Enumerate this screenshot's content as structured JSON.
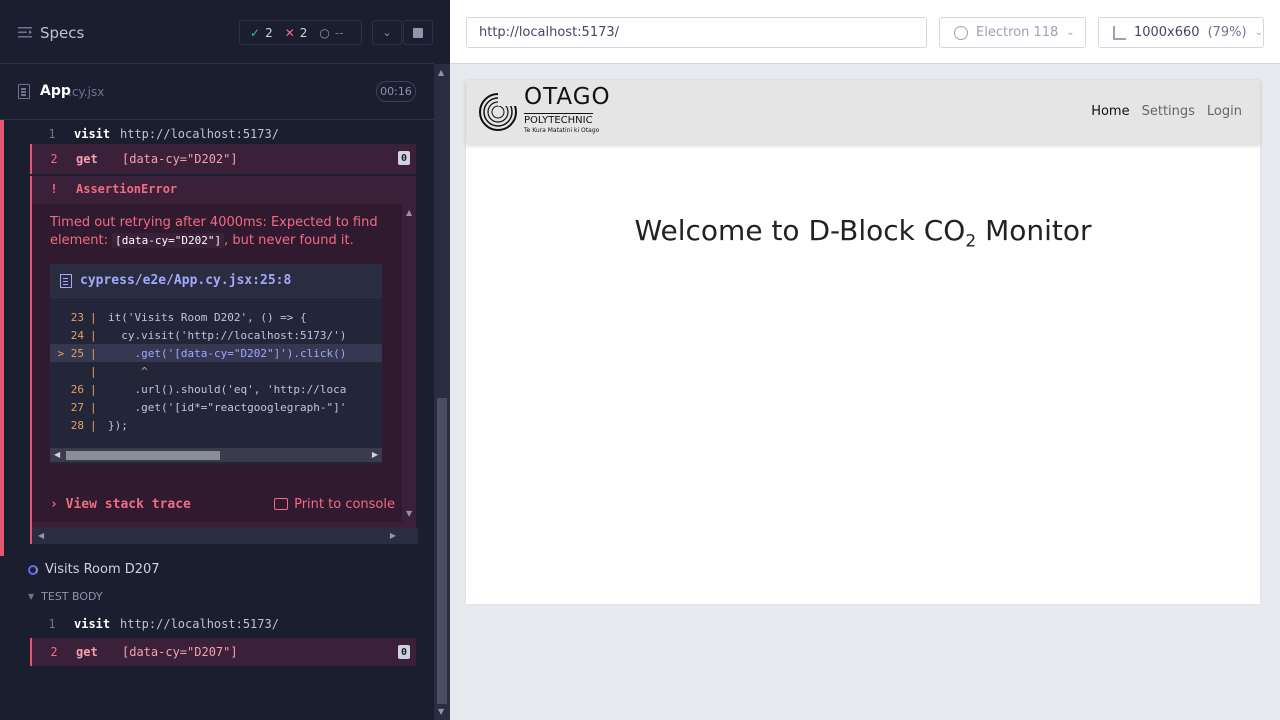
{
  "reporter": {
    "header": {
      "title": "Specs",
      "stats": {
        "passed": "2",
        "failed": "2",
        "pending": "--"
      }
    },
    "spec": {
      "name": "App",
      "ext": ".cy.jsx",
      "duration": "00:16"
    },
    "test1": {
      "commands": [
        {
          "num": "1",
          "name": "visit",
          "message": "http://localhost:5173/"
        },
        {
          "num": "2",
          "name": "get",
          "message": "[data-cy=\"D202\"]",
          "badge": "0"
        }
      ],
      "error": {
        "type": "AssertionError",
        "message_pre": "Timed out retrying after 4000ms: Expected to find element:",
        "message_code": "[data-cy=\"D202\"]",
        "message_post": ", but never found it.",
        "frame_file": "cypress/e2e/App.cy.jsx:25:8",
        "code_lines": [
          {
            "ln": "23",
            "text": "it('Visits Room D202', () => {"
          },
          {
            "ln": "24",
            "text": "  cy.visit('http://localhost:5173/')"
          },
          {
            "ln": "> 25",
            "text": "    .get('[data-cy=\"D202\"]').click()"
          },
          {
            "ln": "",
            "text": "     ^"
          },
          {
            "ln": "26",
            "text": "    .url().should('eq', 'http://loca"
          },
          {
            "ln": "27",
            "text": "    .get('[id*=\"reactgooglegraph-\"]'"
          },
          {
            "ln": "28",
            "text": "});"
          }
        ],
        "stack_trace_label": "View stack trace",
        "print_label": "Print to console"
      }
    },
    "test2": {
      "title": "Visits Room D207",
      "body_label": "TEST BODY",
      "commands": [
        {
          "num": "1",
          "name": "visit",
          "message": "http://localhost:5173/"
        },
        {
          "num": "2",
          "name": "get",
          "message": "[data-cy=\"D207\"]",
          "badge": "0"
        }
      ]
    }
  },
  "aut": {
    "url": "http://localhost:5173/",
    "browser": "Electron 118",
    "viewport": "1000x660",
    "viewport_pct": "(79%)",
    "site": {
      "logo_main": "OTAGO",
      "logo_sub": "POLYTECHNIC",
      "logo_tag": "Te Kura Matatini ki Otago",
      "nav": [
        "Home",
        "Settings",
        "Login"
      ],
      "welcome_pre": "Welcome to D-Block CO",
      "welcome_sub": "2",
      "welcome_post": " Monitor"
    }
  },
  "colors": {
    "fail": "#e45770",
    "pass": "#3fb69a",
    "accent": "#a3a8ff"
  }
}
